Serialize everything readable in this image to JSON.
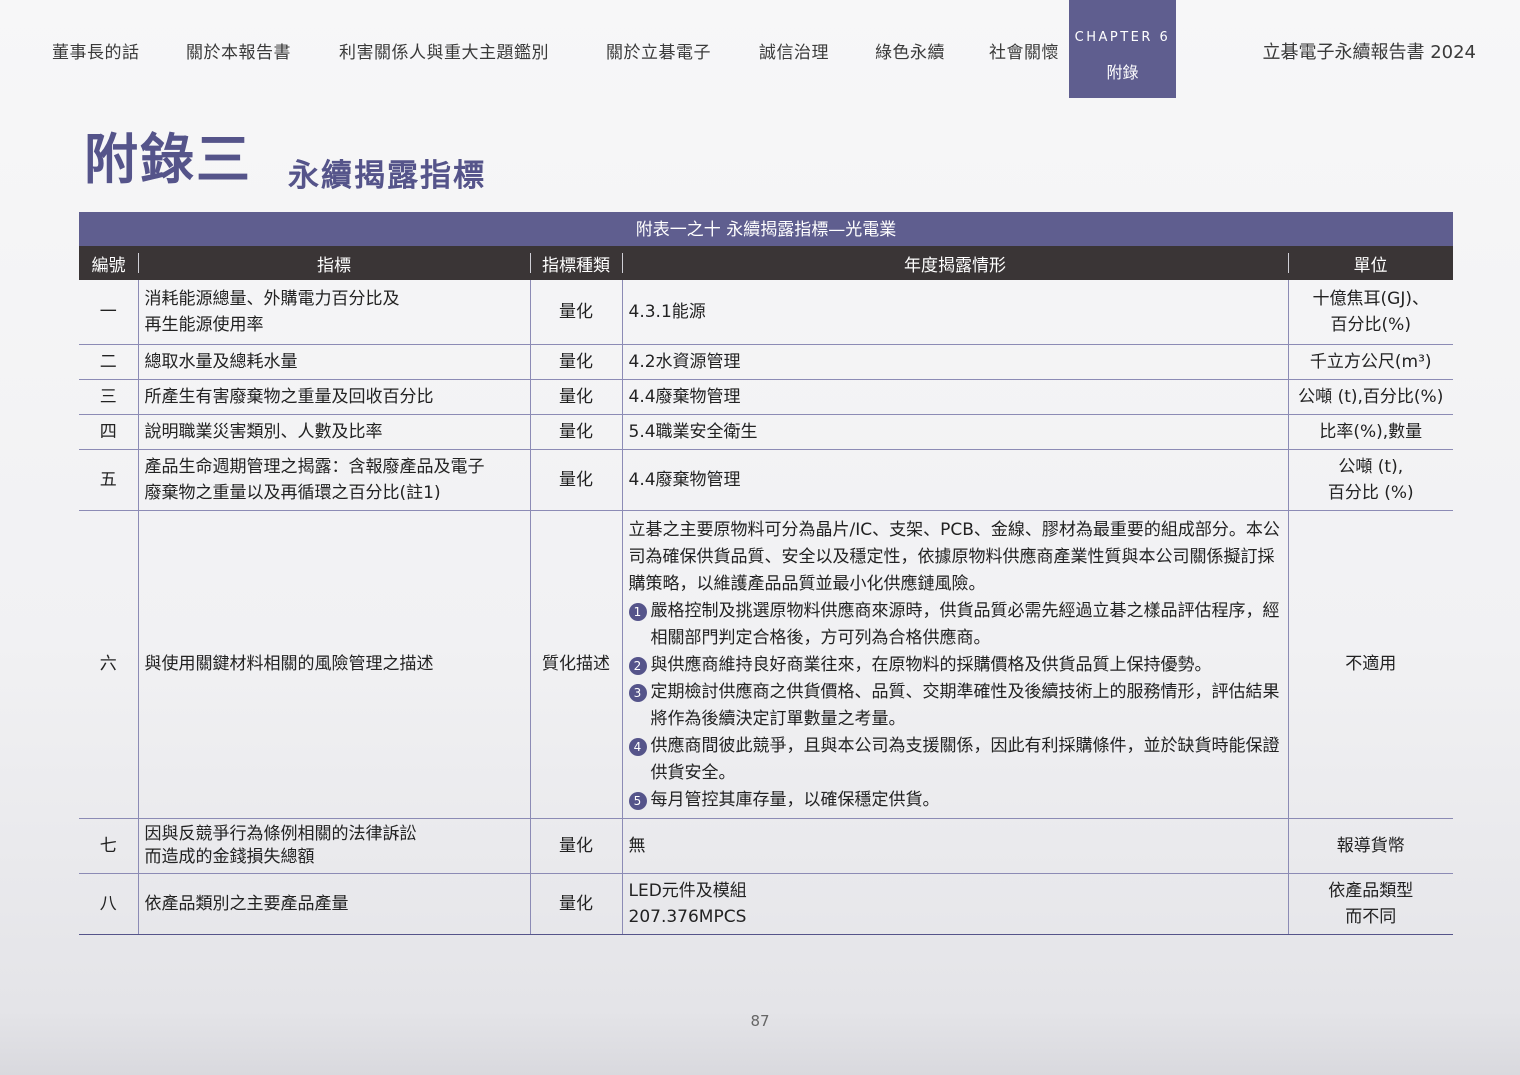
{
  "nav": {
    "items": [
      "董事長的話",
      "關於本報告書",
      "利害關係人與重大主題鑑別",
      "關於立碁電子",
      "誠信治理",
      "綠色永續",
      "社會關懷"
    ],
    "chapter_label": "CHAPTER 6",
    "chapter_name": "附錄",
    "report_title": "立碁電子永續報告書 2024"
  },
  "heading": {
    "main": "附錄三",
    "sub": "永續揭露指標"
  },
  "table": {
    "caption": "附表一之十 永續揭露指標—光電業",
    "headers": [
      "編號",
      "指標",
      "指標種類",
      "年度揭露情形",
      "單位"
    ],
    "rows": [
      {
        "no": "一",
        "name": [
          "消耗能源總量、外購電力百分比及",
          "再生能源使用率"
        ],
        "type": "量化",
        "disclosure": [
          "4.3.1能源"
        ],
        "unit": [
          "十億焦耳(GJ)、",
          "百分比(%)"
        ]
      },
      {
        "no": "二",
        "name": [
          "總取水量及總耗水量"
        ],
        "type": "量化",
        "disclosure": [
          "4.2水資源管理"
        ],
        "unit": [
          "千立方公尺(m³)"
        ]
      },
      {
        "no": "三",
        "name": [
          "所產生有害廢棄物之重量及回收百分比"
        ],
        "type": "量化",
        "disclosure": [
          "4.4廢棄物管理"
        ],
        "unit": [
          "公噸 (t),百分比(%)"
        ]
      },
      {
        "no": "四",
        "name": [
          "說明職業災害類別、人數及比率"
        ],
        "type": "量化",
        "disclosure": [
          "5.4職業安全衛生"
        ],
        "unit": [
          "比率(%),數量"
        ]
      },
      {
        "no": "五",
        "name": [
          "產品生命週期管理之揭露：含報廢產品及電子",
          "廢棄物之重量以及再循環之百分比(註1)"
        ],
        "type": "量化",
        "disclosure": [
          "4.4廢棄物管理"
        ],
        "unit": [
          "公噸 (t),",
          "百分比 (%)"
        ]
      },
      {
        "no": "六",
        "name": [
          "與使用關鍵材料相關的風險管理之描述"
        ],
        "type": "質化描述",
        "intro": "立碁之主要原物料可分為晶片/IC、支架、PCB、金線、膠材為最重要的組成部分。本公司為確保供貨品質、安全以及穩定性，依據原物料供應商產業性質與本公司關係擬訂採購策略，以維護產品品質並最小化供應鏈風險。",
        "list": [
          {
            "badge": "1",
            "text": "嚴格控制及挑選原物料供應商來源時，供貨品質必需先經過立碁之樣品評估程序，經相關部門判定合格後，方可列為合格供應商。"
          },
          {
            "badge": "2",
            "text": "與供應商維持良好商業往來，在原物料的採購價格及供貨品質上保持優勢。"
          },
          {
            "badge": "3",
            "text": "定期檢討供應商之供貨價格、品質、交期準確性及後續技術上的服務情形，評估結果將作為後續決定訂單數量之考量。"
          },
          {
            "badge": "4",
            "text": "供應商間彼此競爭，且與本公司為支援關係，因此有利採購條件，並於缺貨時能保證供貨安全。"
          },
          {
            "badge": "5",
            "text": "每月管控其庫存量，以確保穩定供貨。"
          }
        ],
        "unit": [
          "不適用"
        ]
      },
      {
        "no": "七",
        "name": [
          "因與反競爭行為條例相關的法律訴訟",
          "而造成的金錢損失總額"
        ],
        "type": "量化",
        "disclosure": [
          "無"
        ],
        "unit": [
          "報導貨幣"
        ]
      },
      {
        "no": "八",
        "name": [
          "依產品類別之主要產品產量"
        ],
        "type": "量化",
        "disclosure": [
          "LED元件及模組",
          "207.376MPCS"
        ],
        "unit": [
          "依產品類型",
          "而不同"
        ]
      }
    ]
  },
  "page_number": "87"
}
